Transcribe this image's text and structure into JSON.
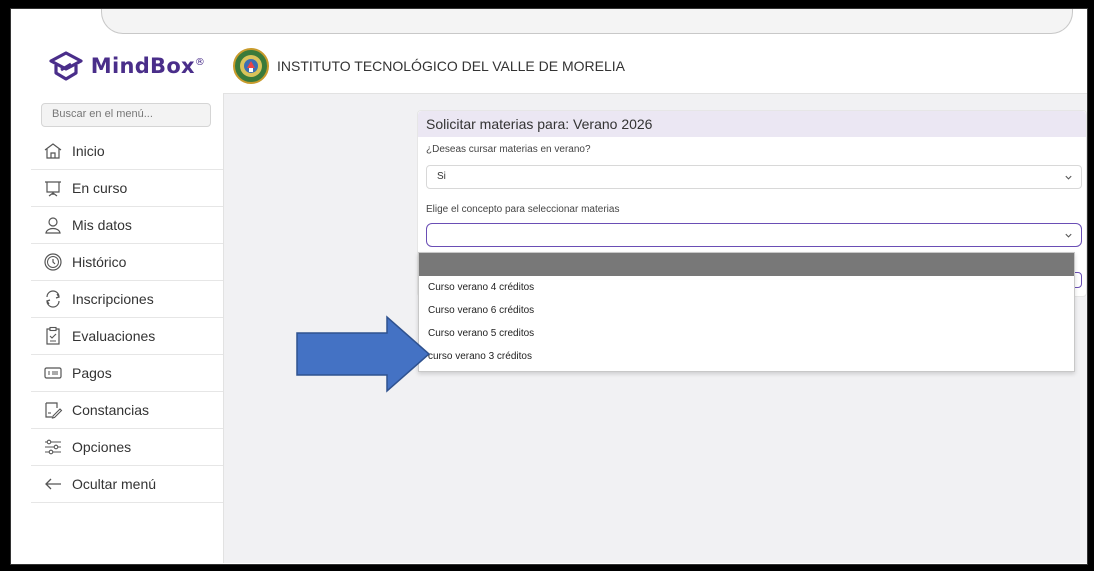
{
  "brand": {
    "name": "MindBox",
    "mark": "®",
    "color": "#4a2e8a"
  },
  "sidebar": {
    "search_placeholder": "Buscar en el menú...",
    "items": [
      {
        "label": "Inicio",
        "icon": "home-icon"
      },
      {
        "label": "En curso",
        "icon": "board-icon"
      },
      {
        "label": "Mis datos",
        "icon": "user-icon"
      },
      {
        "label": "Histórico",
        "icon": "clock-icon"
      },
      {
        "label": "Inscripciones",
        "icon": "refresh-icon"
      },
      {
        "label": "Evaluaciones",
        "icon": "clipboard-icon"
      },
      {
        "label": "Pagos",
        "icon": "payment-card-icon"
      },
      {
        "label": "Constancias",
        "icon": "certificate-icon"
      },
      {
        "label": "Opciones",
        "icon": "sliders-icon"
      },
      {
        "label": "Ocultar menú",
        "icon": "arrow-left-icon"
      }
    ]
  },
  "header": {
    "institution": "INSTITUTO TECNOLÓGICO DEL VALLE DE MORELIA"
  },
  "form": {
    "title": "Solicitar materias para: Verano 2026",
    "question1": "¿Deseas cursar materias en verano?",
    "answer1": "Si",
    "question2": "Elige el concepto para seleccionar materias",
    "answer2": ""
  },
  "dropdown": {
    "options": [
      "Curso verano 4 créditos",
      "Curso verano 6 créditos",
      "Curso verano 5 creditos",
      "curso verano 3 créditos"
    ]
  },
  "colors": {
    "accent": "#6a4eb5",
    "arrow": "#4472c4",
    "title_bar": "#ebe7f3"
  }
}
